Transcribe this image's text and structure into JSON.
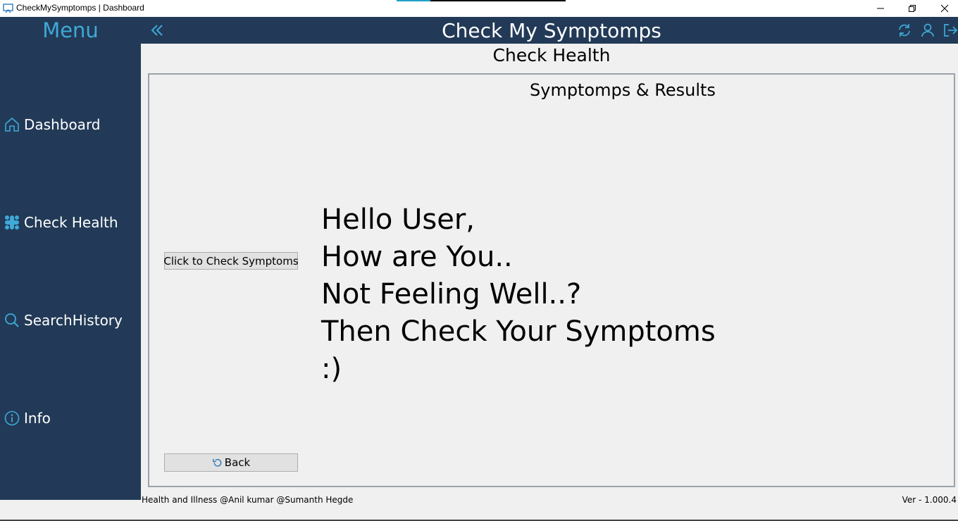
{
  "window": {
    "title": "CheckMySymptomps | Dashboard",
    "minimize_icon": "minimize-icon",
    "restore_icon": "restore-icon",
    "close_icon": "close-icon"
  },
  "sidebar": {
    "menu_title": "Menu",
    "items": [
      {
        "label": "Dashboard",
        "icon": "home-icon"
      },
      {
        "label": "Check Health",
        "icon": "health-icon"
      },
      {
        "label": "SearchHistory",
        "icon": "search-icon"
      },
      {
        "label": "Info",
        "icon": "info-icon"
      }
    ]
  },
  "header": {
    "title": "Check My Symptomps",
    "icons": [
      "collapse-icon",
      "refresh-icon",
      "user-icon",
      "logout-icon"
    ]
  },
  "page": {
    "title": "Check Health",
    "panel_title": "Symptomps & Results",
    "check_button": "Click to Check Symptoms",
    "back_button": "Back",
    "greeting_lines": [
      "Hello User,",
      "How are You..",
      "Not Feeling Well..?",
      "Then Check Your Symptoms",
      ":)"
    ]
  },
  "footer": {
    "credits": "Health and Illness @Anil kumar @Sumanth Hegde",
    "version": "Ver - 1.000.4"
  },
  "colors": {
    "sidebar_bg": "#223a57",
    "accent": "#3fa9d8",
    "content_bg": "#f0f0f0"
  }
}
